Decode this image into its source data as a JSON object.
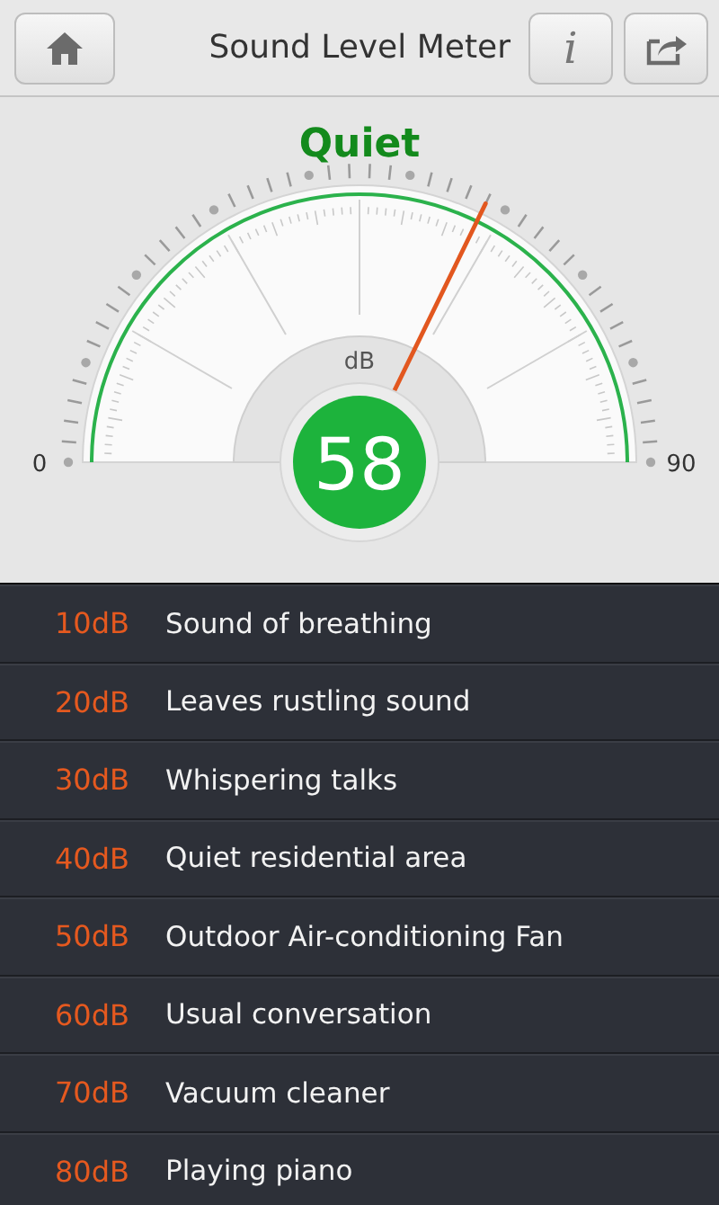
{
  "header": {
    "title": "Sound Level Meter",
    "info_button": "i"
  },
  "gauge": {
    "status": "Quiet",
    "unit": "dB",
    "reading": "58",
    "min_label": "0",
    "max_label": "90"
  },
  "levels": [
    {
      "db": "10dB",
      "description": "Sound of breathing"
    },
    {
      "db": "20dB",
      "description": "Leaves rustling sound"
    },
    {
      "db": "30dB",
      "description": "Whispering talks"
    },
    {
      "db": "40dB",
      "description": "Quiet residential area"
    },
    {
      "db": "50dB",
      "description": "Outdoor Air-conditioning Fan"
    },
    {
      "db": "60dB",
      "description": "Usual conversation"
    },
    {
      "db": "70dB",
      "description": "Vacuum cleaner"
    },
    {
      "db": "80dB",
      "description": "Playing piano"
    }
  ]
}
